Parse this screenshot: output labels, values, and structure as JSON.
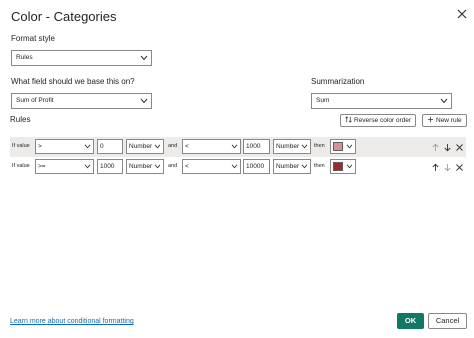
{
  "dialog": {
    "title": "Color - Categories"
  },
  "format_style": {
    "label": "Format style",
    "value": "Rules"
  },
  "base_field": {
    "label": "What field should we base this on?",
    "value": "Sum of Profit"
  },
  "summarization": {
    "label": "Summarization",
    "value": "Sum"
  },
  "rules": {
    "label": "Rules",
    "reverse_label": "Reverse color order",
    "new_rule_label": "New rule",
    "rows": [
      {
        "prefix": "If value",
        "op1": ">",
        "val1": "0",
        "type1": "Number",
        "and_label": "and",
        "op2": "<",
        "val2": "1000",
        "type2": "Number",
        "then_label": "then",
        "color": "#d9929b"
      },
      {
        "prefix": "If value",
        "op1": ">=",
        "val1": "1000",
        "type1": "Number",
        "and_label": "and",
        "op2": "<",
        "val2": "10000",
        "type2": "Number",
        "then_label": "then",
        "color": "#a4262c"
      }
    ]
  },
  "footer": {
    "link": "Learn more about conditional formatting",
    "ok_label": "OK",
    "cancel_label": "Cancel"
  }
}
